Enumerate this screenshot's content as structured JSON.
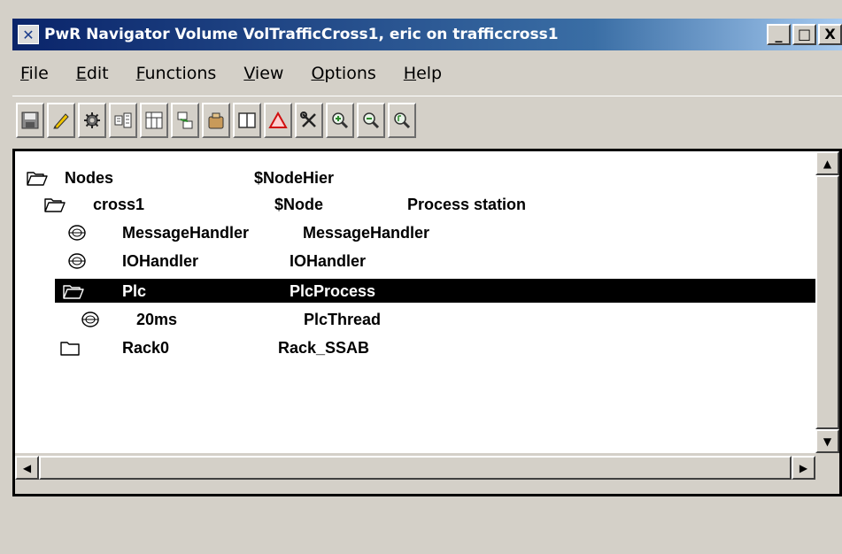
{
  "window": {
    "title": "PwR Navigator Volume VolTrafficCross1, eric on trafficcross1",
    "title_icon": "x-logo-icon",
    "controls": {
      "minimize": "_",
      "maximize": "□",
      "close": "X"
    }
  },
  "menu": [
    {
      "label": "File",
      "mnemonic": "F",
      "rest": "ile"
    },
    {
      "label": "Edit",
      "mnemonic": "E",
      "rest": "dit"
    },
    {
      "label": "Functions",
      "mnemonic": "F",
      "rest": "unctions"
    },
    {
      "label": "View",
      "mnemonic": "V",
      "rest": "iew"
    },
    {
      "label": "Options",
      "mnemonic": "O",
      "rest": "ptions"
    },
    {
      "label": "Help",
      "mnemonic": "H",
      "rest": "elp"
    }
  ],
  "toolbar": [
    "save-icon",
    "edit-pencil-icon",
    "gear-icon",
    "hierarchy-icon",
    "module-icon",
    "merge-icon",
    "package-icon",
    "split-view-icon",
    "warning-triangle-icon",
    "tools-icon",
    "zoom-in-icon",
    "zoom-out-icon",
    "zoom-reset-icon"
  ],
  "tree": {
    "rows": [
      {
        "name": "Nodes",
        "class": "$NodeHier",
        "desc": "",
        "icon": "folder-open-icon",
        "selected": false
      },
      {
        "name": "cross1",
        "class": "$Node",
        "desc": "Process station",
        "icon": "folder-open-icon",
        "selected": false
      },
      {
        "name": "MessageHandler",
        "class": "MessageHandler",
        "desc": "",
        "icon": "leaf-object-icon",
        "selected": false
      },
      {
        "name": "IOHandler",
        "class": "IOHandler",
        "desc": "",
        "icon": "leaf-object-icon",
        "selected": false
      },
      {
        "name": "Plc",
        "class": "PlcProcess",
        "desc": "",
        "icon": "folder-open-icon",
        "selected": true
      },
      {
        "name": "20ms",
        "class": "PlcThread",
        "desc": "",
        "icon": "leaf-object-icon",
        "selected": false
      },
      {
        "name": "Rack0",
        "class": "Rack_SSAB",
        "desc": "",
        "icon": "folder-closed-icon",
        "selected": false
      }
    ]
  },
  "colors": {
    "titlebar_start": "#0a246a",
    "titlebar_end": "#a6caf0",
    "selection_bg": "#000000",
    "selection_fg": "#ffffff",
    "window_bg": "#d4d0c8"
  }
}
